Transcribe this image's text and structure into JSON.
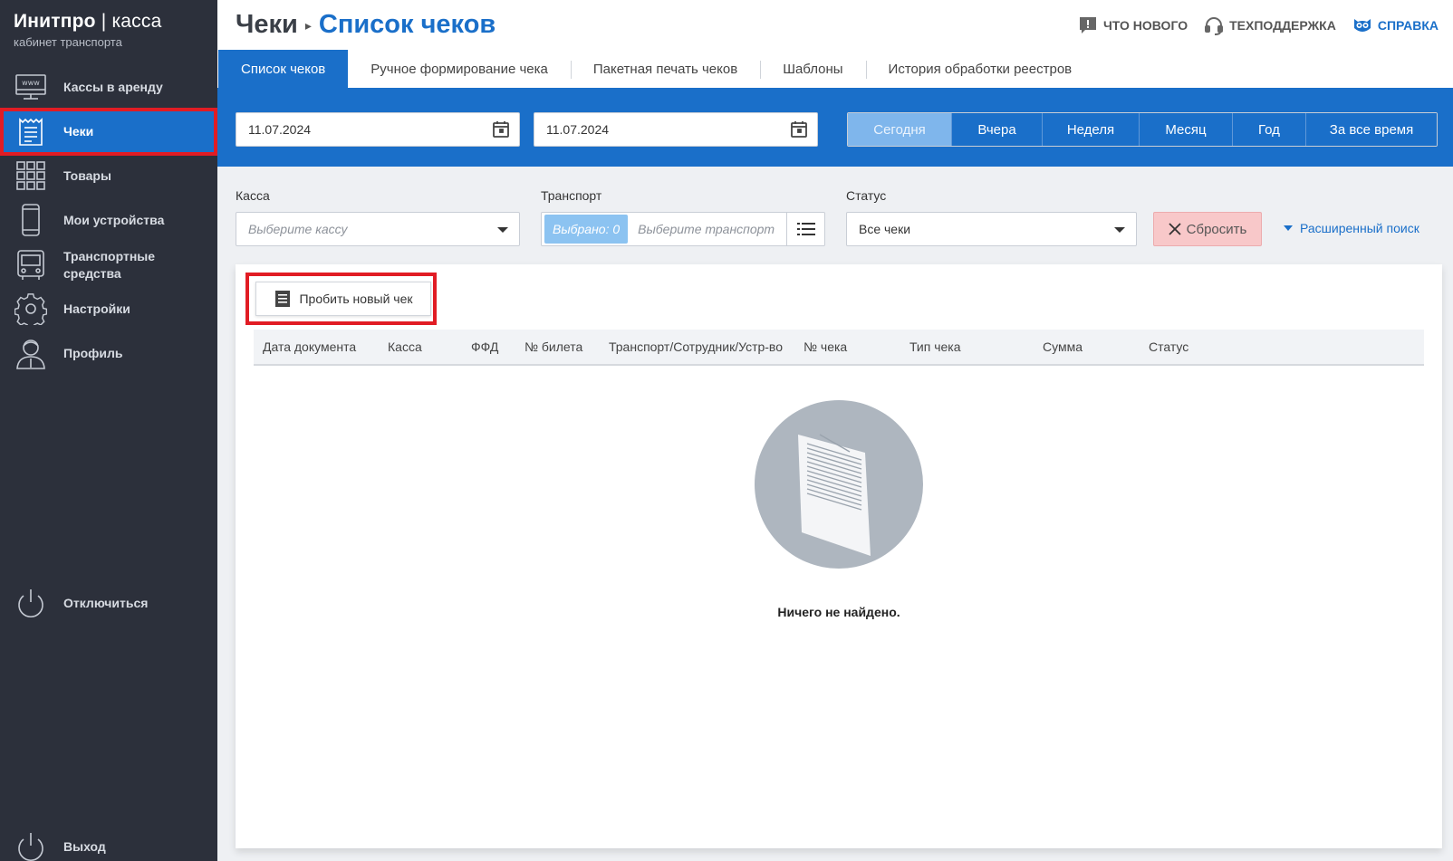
{
  "sidebar": {
    "logo_bold": "Инитпро",
    "logo_sep": " | ",
    "logo_light": "касса",
    "logo_sub": "кабинет транспорта",
    "items": [
      {
        "label": "Кассы в аренду",
        "icon": "www-monitor-icon"
      },
      {
        "label": "Чеки",
        "icon": "receipt-icon"
      },
      {
        "label": "Товары",
        "icon": "grid-icon"
      },
      {
        "label": "Мои устройства",
        "icon": "phone-icon"
      },
      {
        "label": "Транспортные средства",
        "icon": "bus-icon"
      },
      {
        "label": "Настройки",
        "icon": "gear-icon"
      },
      {
        "label": "Профиль",
        "icon": "user-icon"
      }
    ],
    "disconnect": "Отключиться",
    "exit": "Выход"
  },
  "header": {
    "breadcrumb_parent": "Чеки",
    "breadcrumb_current": "Список чеков",
    "links": {
      "whats_new": "ЧТО НОВОГО",
      "support": "ТЕХПОДДЕРЖКА",
      "help": "СПРАВКА"
    }
  },
  "tabs": [
    {
      "label": "Список чеков",
      "active": true
    },
    {
      "label": "Ручное формирование чека",
      "active": false
    },
    {
      "label": "Пакетная печать чеков",
      "active": false
    },
    {
      "label": "Шаблоны",
      "active": false
    },
    {
      "label": "История обработки реестров",
      "active": false
    }
  ],
  "dates": {
    "from": "11.07.2024",
    "to": "11.07.2024"
  },
  "ranges": [
    {
      "label": "Сегодня",
      "active": true
    },
    {
      "label": "Вчера",
      "active": false
    },
    {
      "label": "Неделя",
      "active": false
    },
    {
      "label": "Месяц",
      "active": false
    },
    {
      "label": "Год",
      "active": false
    },
    {
      "label": "За все время",
      "active": false
    }
  ],
  "filters": {
    "kassa_label": "Касса",
    "kassa_placeholder": "Выберите кассу",
    "transport_label": "Транспорт",
    "transport_badge": "Выбрано: 0",
    "transport_placeholder": "Выберите транспорт",
    "status_label": "Статус",
    "status_value": "Все чеки",
    "reset": "Сбросить",
    "advanced": "Расширенный поиск"
  },
  "table": {
    "new_check": "Пробить новый чек",
    "columns": [
      "Дата документа",
      "Касса",
      "ФФД",
      "№ билета",
      "Транспорт/Сотрудник/Устр-во",
      "№ чека",
      "Тип чека",
      "Сумма",
      "Статус"
    ],
    "empty": "Ничего не найдено."
  },
  "colors": {
    "accent": "#1a6fc9",
    "sidebar": "#2c303b",
    "highlight": "#e11c24"
  }
}
